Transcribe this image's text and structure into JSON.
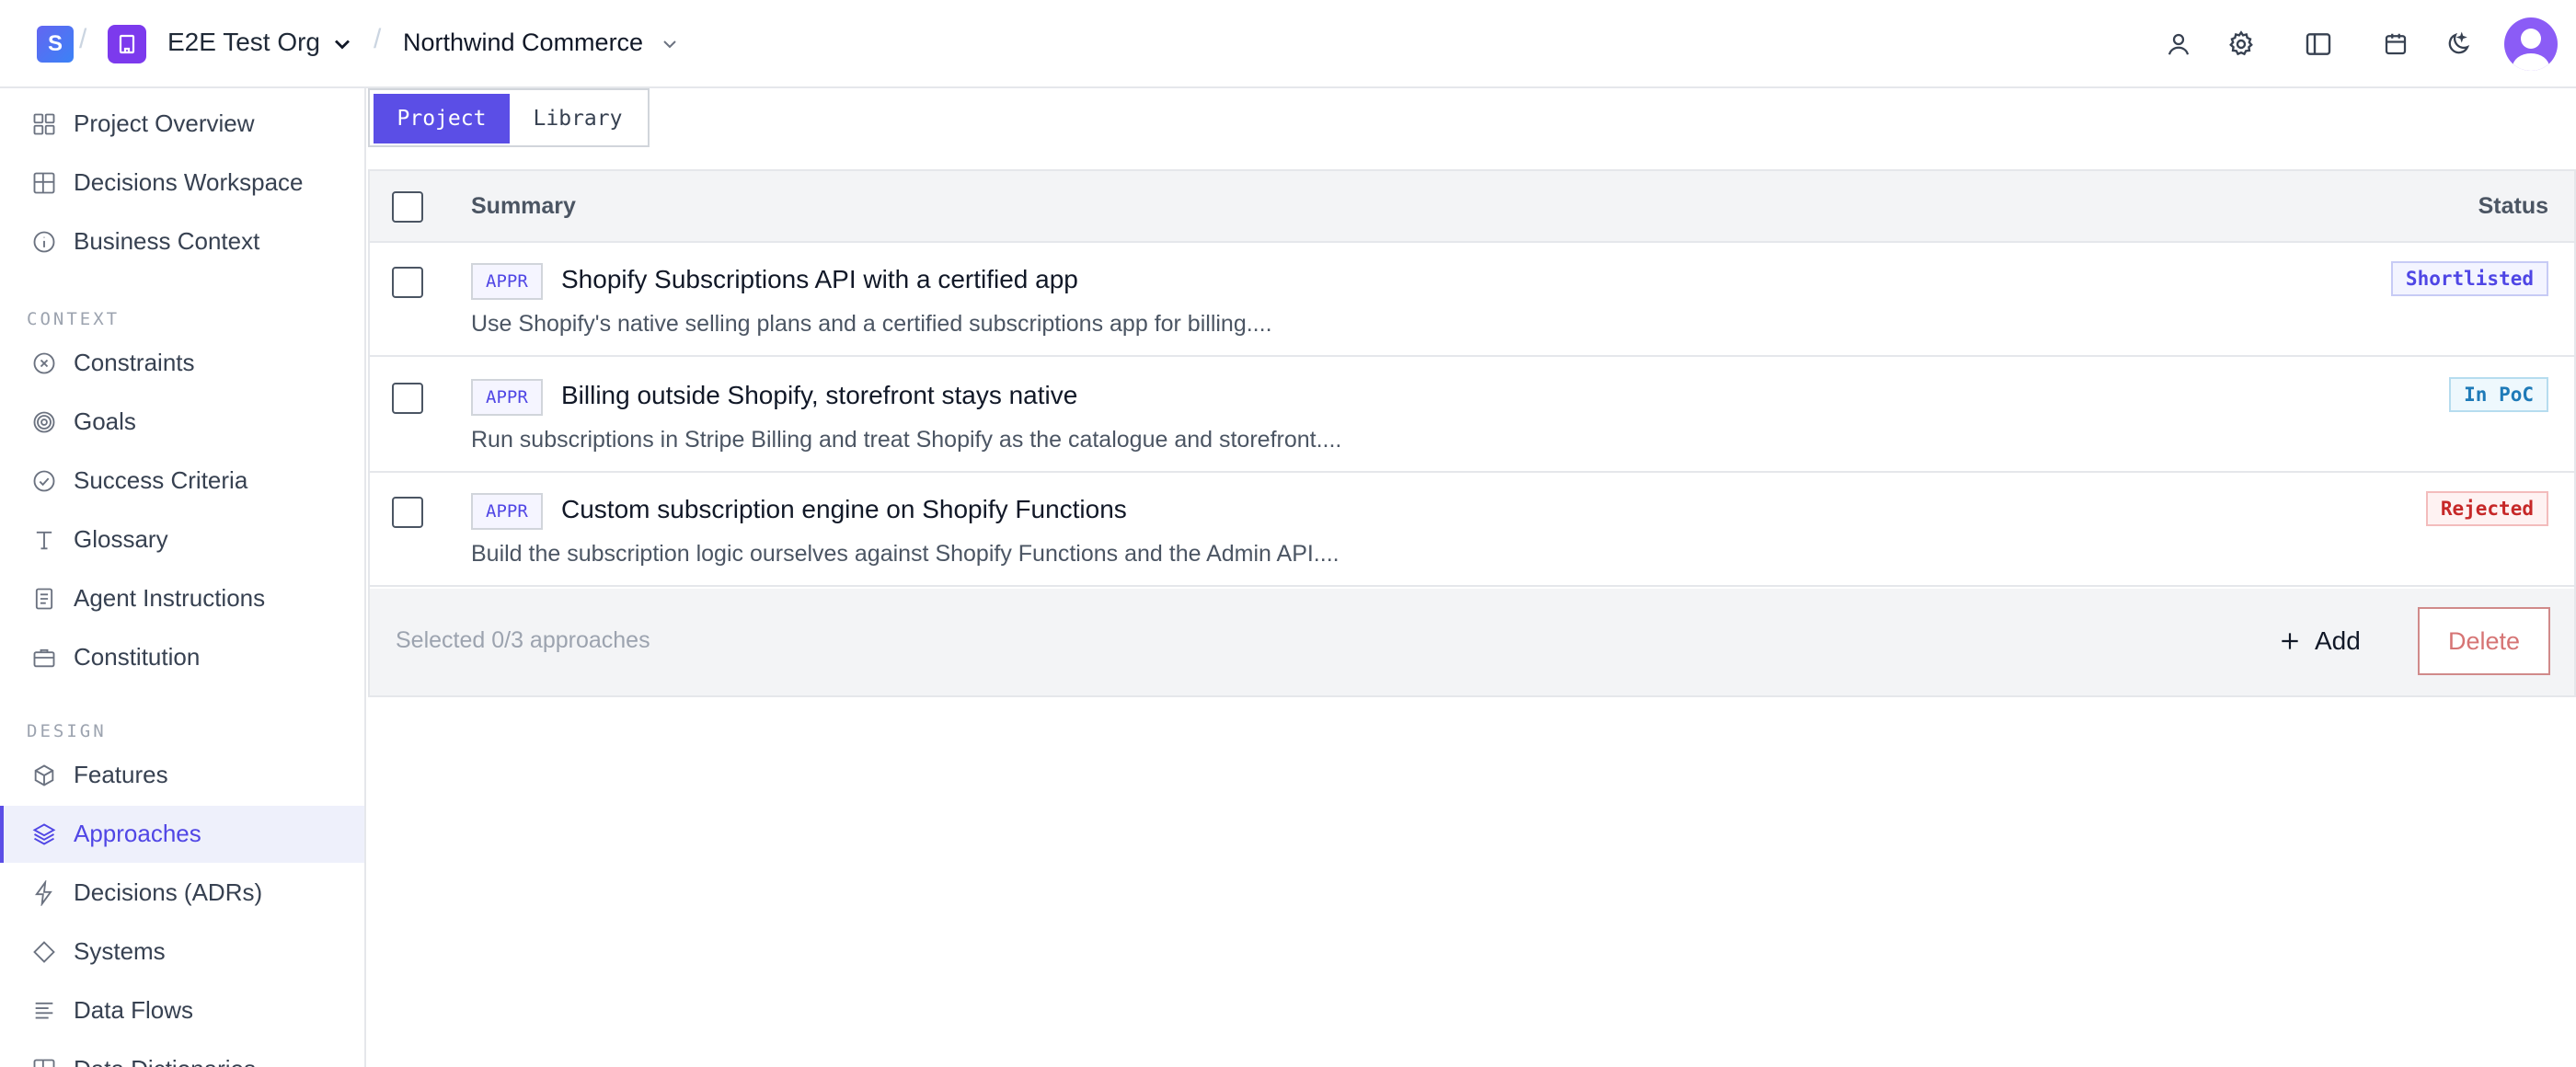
{
  "topbar": {
    "logo_letter": "S",
    "org_name": "E2E Test Org",
    "project_name": "Northwind Commerce",
    "icons": [
      "user-icon",
      "gear-icon",
      "panel-icon",
      "calendar-icon",
      "theme-toggle-icon",
      "avatar"
    ]
  },
  "sidebar": {
    "items": [
      {
        "label": "Project Overview",
        "icon": "grid-icon"
      },
      {
        "label": "Decisions Workspace",
        "icon": "table-icon"
      },
      {
        "label": "Business Context",
        "icon": "info-icon"
      }
    ],
    "sections": [
      {
        "title": "CONTEXT",
        "items": [
          {
            "label": "Constraints",
            "icon": "x-circle-icon"
          },
          {
            "label": "Goals",
            "icon": "target-icon"
          },
          {
            "label": "Success Criteria",
            "icon": "check-circle-icon"
          },
          {
            "label": "Glossary",
            "icon": "type-icon"
          },
          {
            "label": "Agent Instructions",
            "icon": "document-icon"
          },
          {
            "label": "Constitution",
            "icon": "briefcase-icon"
          }
        ]
      },
      {
        "title": "DESIGN",
        "items": [
          {
            "label": "Features",
            "icon": "box-icon"
          },
          {
            "label": "Approaches",
            "icon": "layers-icon",
            "active": true
          },
          {
            "label": "Decisions (ADRs)",
            "icon": "bolt-icon"
          },
          {
            "label": "Systems",
            "icon": "diamond-icon"
          },
          {
            "label": "Data Flows",
            "icon": "list-icon"
          },
          {
            "label": "Data Dictionaries",
            "icon": "table-icon"
          }
        ]
      }
    ]
  },
  "tabs": {
    "project": "Project",
    "library": "Library",
    "active": "Project"
  },
  "table": {
    "headers": {
      "summary": "Summary",
      "status": "Status"
    },
    "rows": [
      {
        "badge": "APPR",
        "title": "Shopify Subscriptions API with a certified app",
        "description": "Use Shopify's native selling plans and a certified subscriptions app for billing....",
        "status": "Shortlisted",
        "status_colors": {
          "text": "#4f46e5",
          "border": "#c7cbf5",
          "bg": "#f3f4ff"
        }
      },
      {
        "badge": "APPR",
        "title": "Billing outside Shopify, storefront stays native",
        "description": "Run subscriptions in Stripe Billing and treat Shopify as the catalogue and storefront....",
        "status": "In PoC",
        "status_colors": {
          "text": "#1e7ab8",
          "border": "#b6dcef",
          "bg": "#eef8fd"
        }
      },
      {
        "badge": "APPR",
        "title": "Custom subscription engine on Shopify Functions",
        "description": "Build the subscription logic ourselves against Shopify Functions and the Admin API....",
        "status": "Rejected",
        "status_colors": {
          "text": "#c62828",
          "border": "#f3bcbc",
          "bg": "#fef2f2"
        }
      }
    ],
    "footer": {
      "selected_text": "Selected 0/3 approaches",
      "add_label": "Add",
      "delete_label": "Delete"
    }
  },
  "colors": {
    "accent": "#5b4ee6",
    "border": "#e5e7eb",
    "muted": "#9ca3af"
  }
}
